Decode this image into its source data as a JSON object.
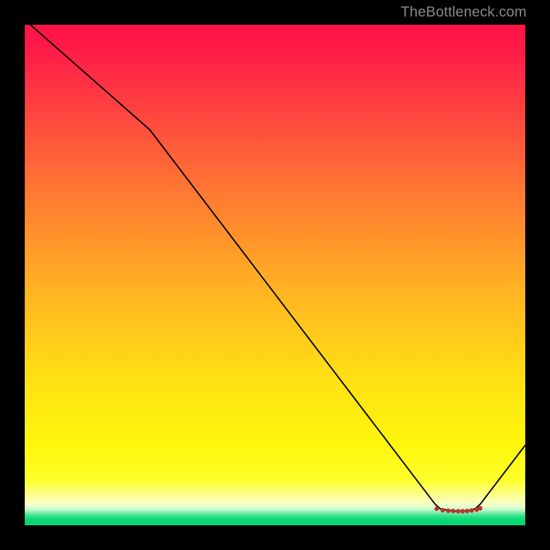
{
  "watermark": "TheBottleneck.com",
  "chart_data": {
    "type": "line",
    "title": "",
    "xlabel": "",
    "ylabel": "",
    "xlim": [
      0,
      100
    ],
    "ylim": [
      0,
      100
    ],
    "series": [
      {
        "name": "trace",
        "x": [
          0,
          25,
          82,
          83,
          84.5,
          86,
          87.5,
          89,
          90,
          91,
          100
        ],
        "y": [
          101,
          79,
          4.2,
          3.3,
          3.0,
          2.8,
          2.8,
          3.0,
          3.3,
          4.2,
          16
        ]
      }
    ],
    "flat_band_markers": {
      "note": "small red dots along the valley floor",
      "x": [
        82.3,
        83.5,
        84.6,
        85.6,
        86.6,
        87.5,
        88.4,
        89.3,
        90.3,
        91.0
      ],
      "y": [
        3.3,
        3.0,
        2.9,
        2.85,
        2.8,
        2.8,
        2.85,
        2.95,
        3.1,
        3.4
      ]
    },
    "background_gradient": {
      "direction": "vertical",
      "stops": [
        {
          "pos": 0.0,
          "color": "#ff1347"
        },
        {
          "pos": 0.34,
          "color": "#ff7a33"
        },
        {
          "pos": 0.72,
          "color": "#ffe313"
        },
        {
          "pos": 0.95,
          "color": "#fbffb8"
        },
        {
          "pos": 0.985,
          "color": "#20df80"
        },
        {
          "pos": 1.0,
          "color": "#06d873"
        }
      ]
    }
  }
}
